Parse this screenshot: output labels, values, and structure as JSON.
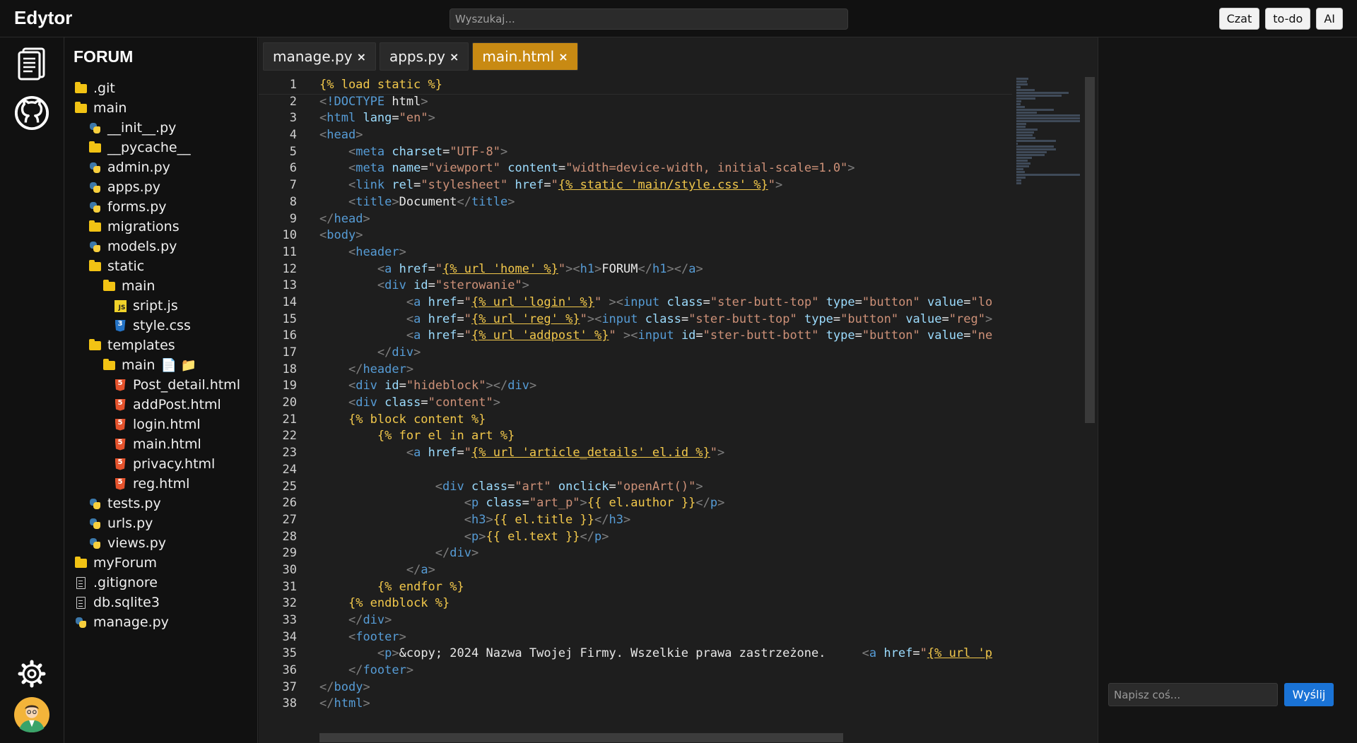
{
  "app": {
    "title": "Edytor"
  },
  "search": {
    "placeholder": "Wyszukaj..."
  },
  "top_buttons": [
    "Czat",
    "to-do",
    "AI"
  ],
  "sidebar_icons": [
    "document-icon",
    "github-icon",
    "gear-icon",
    "avatar"
  ],
  "tree": {
    "title": "FORUM",
    "items": [
      {
        "label": ".git",
        "icon": "folder-icon",
        "depth": 0
      },
      {
        "label": "main",
        "icon": "folder-icon",
        "depth": 0
      },
      {
        "label": "__init__.py",
        "icon": "python-icon",
        "depth": 1
      },
      {
        "label": "__pycache__",
        "icon": "folder-icon",
        "depth": 1
      },
      {
        "label": "admin.py",
        "icon": "python-icon",
        "depth": 1
      },
      {
        "label": "apps.py",
        "icon": "python-icon",
        "depth": 1
      },
      {
        "label": "forms.py",
        "icon": "python-icon",
        "depth": 1
      },
      {
        "label": "migrations",
        "icon": "folder-icon",
        "depth": 1
      },
      {
        "label": "models.py",
        "icon": "python-icon",
        "depth": 1
      },
      {
        "label": "static",
        "icon": "folder-icon",
        "depth": 1
      },
      {
        "label": "main",
        "icon": "folder-icon",
        "depth": 2
      },
      {
        "label": "sript.js",
        "icon": "js-icon",
        "depth": 3
      },
      {
        "label": "style.css",
        "icon": "css-icon",
        "depth": 3
      },
      {
        "label": "templates",
        "icon": "folder-icon",
        "depth": 1
      },
      {
        "label": "main",
        "icon": "folder-icon",
        "depth": 2,
        "extra": "📄  📁"
      },
      {
        "label": "Post_detail.html",
        "icon": "html-icon",
        "depth": 3
      },
      {
        "label": "addPost.html",
        "icon": "html-icon",
        "depth": 3
      },
      {
        "label": "login.html",
        "icon": "html-icon",
        "depth": 3
      },
      {
        "label": "main.html",
        "icon": "html-icon",
        "depth": 3
      },
      {
        "label": "privacy.html",
        "icon": "html-icon",
        "depth": 3
      },
      {
        "label": "reg.html",
        "icon": "html-icon",
        "depth": 3
      },
      {
        "label": "tests.py",
        "icon": "python-icon",
        "depth": 1
      },
      {
        "label": "urls.py",
        "icon": "python-icon",
        "depth": 1
      },
      {
        "label": "views.py",
        "icon": "python-icon",
        "depth": 1
      },
      {
        "label": "myForum",
        "icon": "folder-icon",
        "depth": 0
      },
      {
        "label": ".gitignore",
        "icon": "file-icon",
        "depth": 0
      },
      {
        "label": "db.sqlite3",
        "icon": "file-icon",
        "depth": 0
      },
      {
        "label": "manage.py",
        "icon": "python-icon",
        "depth": 0
      }
    ]
  },
  "editor": {
    "tabs": [
      {
        "label": "manage.py",
        "active": false
      },
      {
        "label": "apps.py",
        "active": false
      },
      {
        "label": "main.html",
        "active": true
      }
    ],
    "close_glyph": "×",
    "lines": [
      "{% load static %}",
      "<!DOCTYPE html>",
      "<html lang=\"en\">",
      "<head>",
      "    <meta charset=\"UTF-8\">",
      "    <meta name=\"viewport\" content=\"width=device-width, initial-scale=1.0\">",
      "    <link rel=\"stylesheet\" href=\"{% static 'main/style.css' %}\">",
      "    <title>Document</title>",
      "</head>",
      "<body>",
      "    <header>",
      "        <a href=\"{% url 'home' %}\"><h1>FORUM</h1></a>",
      "        <div id=\"sterowanie\">",
      "            <a href=\"{% url 'login' %}\" ><input class=\"ster-butt-top\" type=\"button\" value=\"lo",
      "            <a href=\"{% url 'reg' %}\"><input class=\"ster-butt-top\" type=\"button\" value=\"reg\">",
      "            <a href=\"{% url 'addpost' %}\" ><input id=\"ster-butt-bott\" type=\"button\" value=\"ne",
      "        </div>",
      "    </header>",
      "    <div id=\"hideblock\"></div>",
      "    <div class=\"content\">",
      "    {% block content %}",
      "        {% for el in art %}",
      "            <a href=\"{% url 'article_details' el.id %}\">",
      "",
      "                <div class=\"art\" onclick=\"openArt()\">",
      "                    <p class=\"art_p\">{{ el.author }}</p>",
      "                    <h3>{{ el.title }}</h3>",
      "                    <p>{{ el.text }}</p>",
      "                </div>",
      "            </a>",
      "        {% endfor %}",
      "    {% endblock %}",
      "    </div>",
      "    <footer>",
      "        <p>&copy; 2024 Nazwa Twojej Firmy. Wszelkie prawa zastrzeżone.     <a href=\"{% url 'p",
      "    </footer>",
      "</body>",
      "</html>"
    ]
  },
  "chat": {
    "placeholder": "Napisz coś...",
    "send_label": "Wyślij"
  },
  "colors": {
    "tab_active": "#c88a13",
    "send_button": "#1a73d6",
    "tag": "#569cd6",
    "attr": "#9cdcfe",
    "string": "#ce9178",
    "template": "#f2c84b",
    "bracket": "#808080"
  }
}
